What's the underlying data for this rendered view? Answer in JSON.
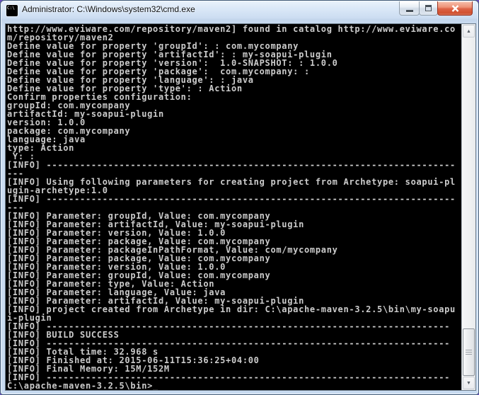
{
  "window": {
    "title": "Administrator: C:\\Windows\\system32\\cmd.exe",
    "icon_text": "C:\\",
    "icons": {
      "minimize": "horizontal-bar",
      "maximize": "square-outline",
      "close": "x-cross"
    }
  },
  "console": {
    "background_color": "#000000",
    "text_color": "#cccccc",
    "lines": [
      "http://www.eviware.com/repository/maven2] found in catalog http://www.eviware.co",
      "m/repository/maven2",
      "Define value for property 'groupId': : com.mycompany",
      "Define value for property 'artifactId': : my-soapui-plugin",
      "Define value for property 'version':  1.0-SNAPSHOT: : 1.0.0",
      "Define value for property 'package':  com.mycompany: : ",
      "Define value for property 'language': : java",
      "Define value for property 'type': : Action",
      "Confirm properties configuration:",
      "groupId: com.mycompany",
      "artifactId: my-soapui-plugin",
      "version: 1.0.0",
      "package: com.mycompany",
      "language: java",
      "type: Action",
      " Y: : ",
      "[INFO] -------------------------------------------------------------------------",
      "---",
      "[INFO] Using following parameters for creating project from Archetype: soapui-pl",
      "ugin-archetype:1.0",
      "[INFO] -------------------------------------------------------------------------",
      "---",
      "[INFO] Parameter: groupId, Value: com.mycompany",
      "[INFO] Parameter: artifactId, Value: my-soapui-plugin",
      "[INFO] Parameter: version, Value: 1.0.0",
      "[INFO] Parameter: package, Value: com.mycompany",
      "[INFO] Parameter: packageInPathFormat, Value: com/mycompany",
      "[INFO] Parameter: package, Value: com.mycompany",
      "[INFO] Parameter: version, Value: 1.0.0",
      "[INFO] Parameter: groupId, Value: com.mycompany",
      "[INFO] Parameter: type, Value: Action",
      "[INFO] Parameter: language, Value: java",
      "[INFO] Parameter: artifactId, Value: my-soapui-plugin",
      "[INFO] project created from Archetype in dir: C:\\apache-maven-3.2.5\\bin\\my-soapu",
      "i-plugin",
      "[INFO] ------------------------------------------------------------------------",
      "[INFO] BUILD SUCCESS",
      "[INFO] ------------------------------------------------------------------------",
      "[INFO] Total time: 32.968 s",
      "[INFO] Finished at: 2015-06-11T15:36:25+04:00",
      "[INFO] Final Memory: 15M/152M",
      "[INFO] ------------------------------------------------------------------------",
      "C:\\apache-maven-3.2.5\\bin>_"
    ]
  },
  "scrollbar": {
    "orientation": "vertical",
    "up_glyph": "▲",
    "down_glyph": "▼"
  },
  "theme": {
    "titlebar_gradient_top": "#eaf2fc",
    "titlebar_gradient_bottom": "#c3d6ec",
    "frame_color": "#c8dbf0",
    "close_button_color": "#dd6347",
    "window_border_color": "#3f5a78"
  }
}
